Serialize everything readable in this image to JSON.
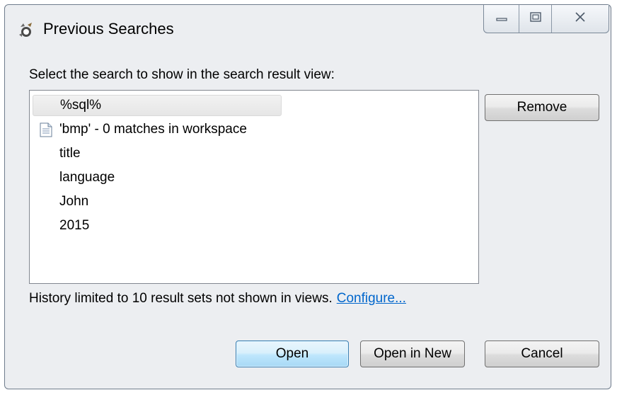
{
  "window": {
    "title": "Previous Searches",
    "controls": {
      "minimize_icon": "minimize-icon",
      "maximize_icon": "maximize-icon",
      "close_icon": "close-icon"
    }
  },
  "dialog": {
    "instruction": "Select the search to show in the search result view:",
    "searches": [
      {
        "label": "%sql%",
        "selected": true,
        "icon": ""
      },
      {
        "label": "'bmp' - 0 matches in workspace",
        "selected": false,
        "icon": "search-result-file-icon"
      },
      {
        "label": "title",
        "selected": false,
        "icon": ""
      },
      {
        "label": "language",
        "selected": false,
        "icon": ""
      },
      {
        "label": "John",
        "selected": false,
        "icon": ""
      },
      {
        "label": "2015",
        "selected": false,
        "icon": ""
      }
    ],
    "remove_label": "Remove",
    "history_text": "History limited to 10 result sets not shown in views.",
    "configure_link": "Configure...",
    "open_label": "Open",
    "open_new_label": "Open in New",
    "cancel_label": "Cancel"
  },
  "colors": {
    "window_bg": "#eceef1",
    "link": "#0066cc",
    "default_button_border": "#3c7fb1"
  }
}
